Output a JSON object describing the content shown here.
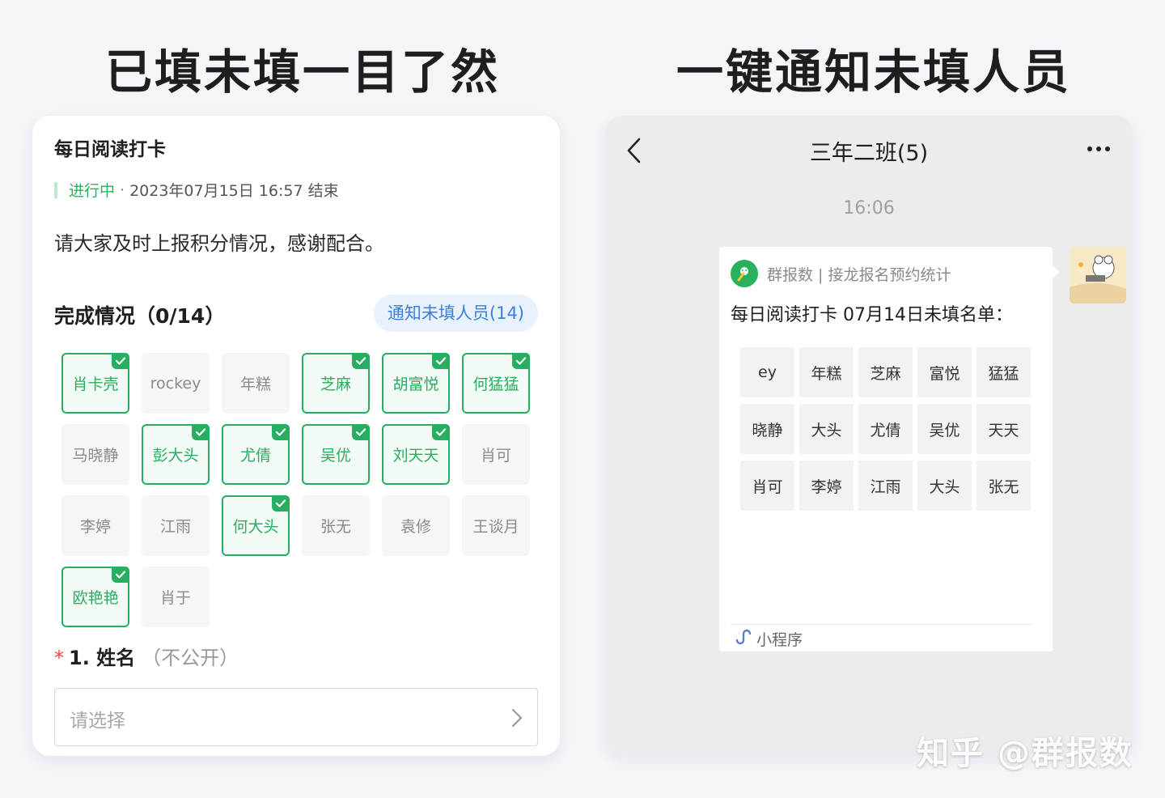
{
  "headlines": {
    "left": "已填未填一目了然",
    "right": "一键通知未填人员"
  },
  "form_card": {
    "title": "每日阅读打卡",
    "status": "进行中",
    "separator": "·",
    "end_time": "2023年07月15日 16:57 结束",
    "description": "请大家及时上报积分情况，感谢配合。",
    "progress_title": "完成情况（0/14）",
    "notify_button": "通知未填人员(14)",
    "members": [
      {
        "name": "肖卡壳",
        "done": true
      },
      {
        "name": "rockey",
        "done": false
      },
      {
        "name": "年糕",
        "done": false
      },
      {
        "name": "芝麻",
        "done": true
      },
      {
        "name": "胡富悦",
        "done": true
      },
      {
        "name": "何猛猛",
        "done": true
      },
      {
        "name": "马晓静",
        "done": false
      },
      {
        "name": "彭大头",
        "done": true
      },
      {
        "name": "尤倩",
        "done": true
      },
      {
        "name": "吴优",
        "done": true
      },
      {
        "name": "刘天天",
        "done": true
      },
      {
        "name": "肖可",
        "done": false
      },
      {
        "name": "李婷",
        "done": false
      },
      {
        "name": "江雨",
        "done": false
      },
      {
        "name": "何大头",
        "done": true
      },
      {
        "name": "张无",
        "done": false
      },
      {
        "name": "袁修",
        "done": false
      },
      {
        "name": "王谈月",
        "done": false
      },
      {
        "name": "欧艳艳",
        "done": true
      },
      {
        "name": "肖于",
        "done": false
      }
    ],
    "question": {
      "required_mark": "*",
      "label": "1. 姓名",
      "note": "（不公开）",
      "placeholder": "请选择"
    }
  },
  "chat": {
    "title": "三年二班(5)",
    "time": "16:06",
    "message": {
      "app_name": "群报数 | 接龙报名预约统计",
      "title": "每日阅读打卡 07月14日未填名单：",
      "names": [
        "ey",
        "年糕",
        "芝麻",
        "富悦",
        "猛猛",
        "晓静",
        "大头",
        "尤倩",
        "吴优",
        "天天",
        "肖可",
        "李婷",
        "江雨",
        "大头",
        "张无"
      ],
      "footer": "小程序"
    }
  },
  "watermark": "知乎 @群报数",
  "colors": {
    "accent_green": "#27ae60",
    "accent_blue": "#3a7fe0",
    "required_red": "#e04b3c"
  }
}
